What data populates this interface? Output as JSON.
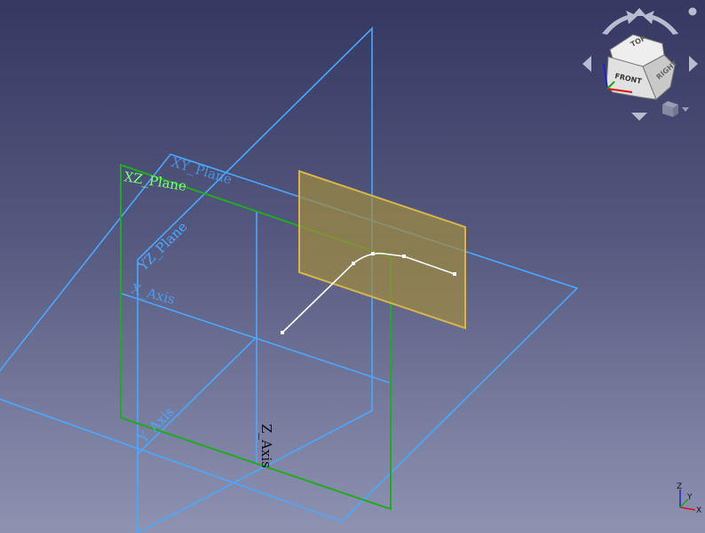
{
  "scene": {
    "labels": {
      "xz_plane": "XZ_Plane",
      "xy_plane": "XY_Plane",
      "yz_plane": "YZ_Plane",
      "x_axis": "X_Axis",
      "y_axis": "Y_Axis",
      "z_axis": "Z_Axis"
    },
    "colors": {
      "background_top": "#343862",
      "background_bottom": "#8f93b2",
      "datum_plane_blue": "#4aa8ff",
      "xz_plane_green": "#22aa22",
      "xz_label_green": "#7dff7d",
      "sketch_plane_fill": "#a08a40",
      "sketch_plane_edge": "#d6b64a",
      "curve_white": "#ffffff"
    }
  },
  "navcube": {
    "faces": {
      "front": "FRONT",
      "top": "TOP",
      "right": "RIGHT"
    }
  },
  "axis_indicator": {
    "x": "X",
    "y": "Y",
    "z": "Z"
  }
}
